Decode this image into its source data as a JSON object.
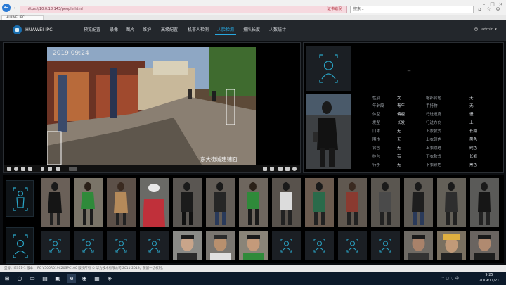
{
  "browser": {
    "url": "https://10.0.18.143/people.html",
    "cert_warning": "证书错误",
    "search_placeholder": "搜索...",
    "tab_title": "HUAWEI IPC",
    "back_icon": "back-arrow-icon",
    "forward_icon": "forward-arrow-icon",
    "home_icon": "home-icon",
    "star_icon": "star-icon",
    "settings_icon": "gear-icon"
  },
  "app": {
    "title": "HUAWEI IPC",
    "nav": [
      {
        "label": "预览配置"
      },
      {
        "label": "录像"
      },
      {
        "label": "图片"
      },
      {
        "label": "维护"
      },
      {
        "label": "高级配置"
      },
      {
        "label": "机非人检测"
      },
      {
        "label": "人脸检测"
      },
      {
        "label": "排队长度"
      },
      {
        "label": "人数统计"
      }
    ],
    "active_nav": "人脸检测",
    "user": "admin"
  },
  "video": {
    "clock": "2019 09:24",
    "caption": "东大街城建铺面"
  },
  "attributes": {
    "empty_value": "--",
    "left": [
      {
        "label": "性别",
        "value": "女"
      },
      {
        "label": "年龄段",
        "value": "青年"
      },
      {
        "label": "体型",
        "value": "偏瘦"
      },
      {
        "label": "发型",
        "value": "长发"
      },
      {
        "label": "口罩",
        "value": "无"
      },
      {
        "label": "围巾",
        "value": "无"
      },
      {
        "label": "背包",
        "value": "无"
      },
      {
        "label": "拎包",
        "value": "有"
      },
      {
        "label": "行李",
        "value": "无"
      }
    ],
    "right": [
      {
        "label": "帽衫背包",
        "value": "无"
      },
      {
        "label": "手持物",
        "value": "无"
      },
      {
        "label": "行进速度",
        "value": "慢"
      },
      {
        "label": "行进方向",
        "value": "上"
      },
      {
        "label": "上衣款式",
        "value": "长袖"
      },
      {
        "label": "上衣颜色",
        "value": "黑色"
      },
      {
        "label": "上衣纹理",
        "value": "纯色"
      },
      {
        "label": "下衣款式",
        "value": "长裤"
      },
      {
        "label": "下衣颜色",
        "value": "黑色"
      }
    ]
  },
  "status": {
    "text": "型号：IES11-1   版本：IPC V500R019C20SPC100   版权所有 © 华为技术有限公司 2011-2019。保留一切权利。"
  },
  "taskbar": {
    "time": "9:25",
    "date": "2019/11/21",
    "tray": "^ ◻ ♫ 中"
  }
}
